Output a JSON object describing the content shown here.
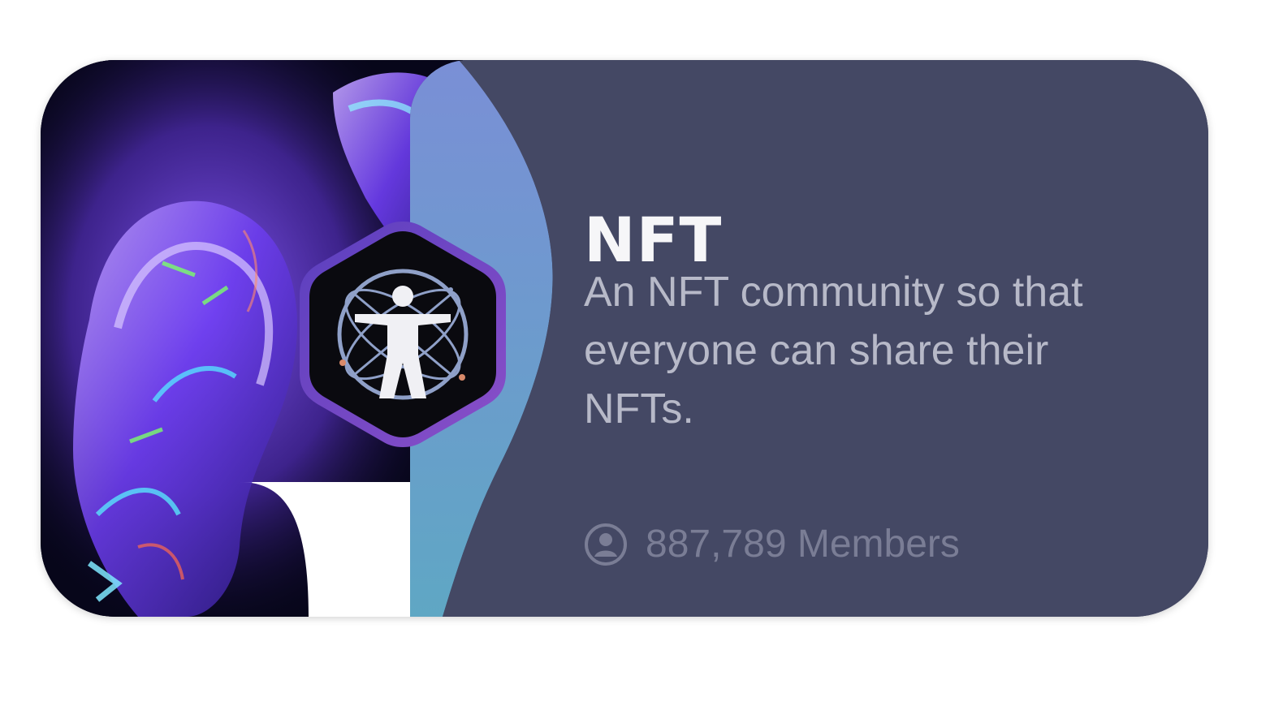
{
  "community": {
    "title": "NFT",
    "description": "An NFT community so that everyone can share their NFTs.",
    "members_text": "887,789 Members",
    "member_count": 887789
  },
  "icons": {
    "badge": "vitruvian-man-icon",
    "members": "user-circle-icon"
  },
  "colors": {
    "panel": "#444864",
    "accent_wave": "#6a86c8",
    "title": "#f6f6f8",
    "description": "#b7b9c8",
    "members": "#7a7d95"
  }
}
